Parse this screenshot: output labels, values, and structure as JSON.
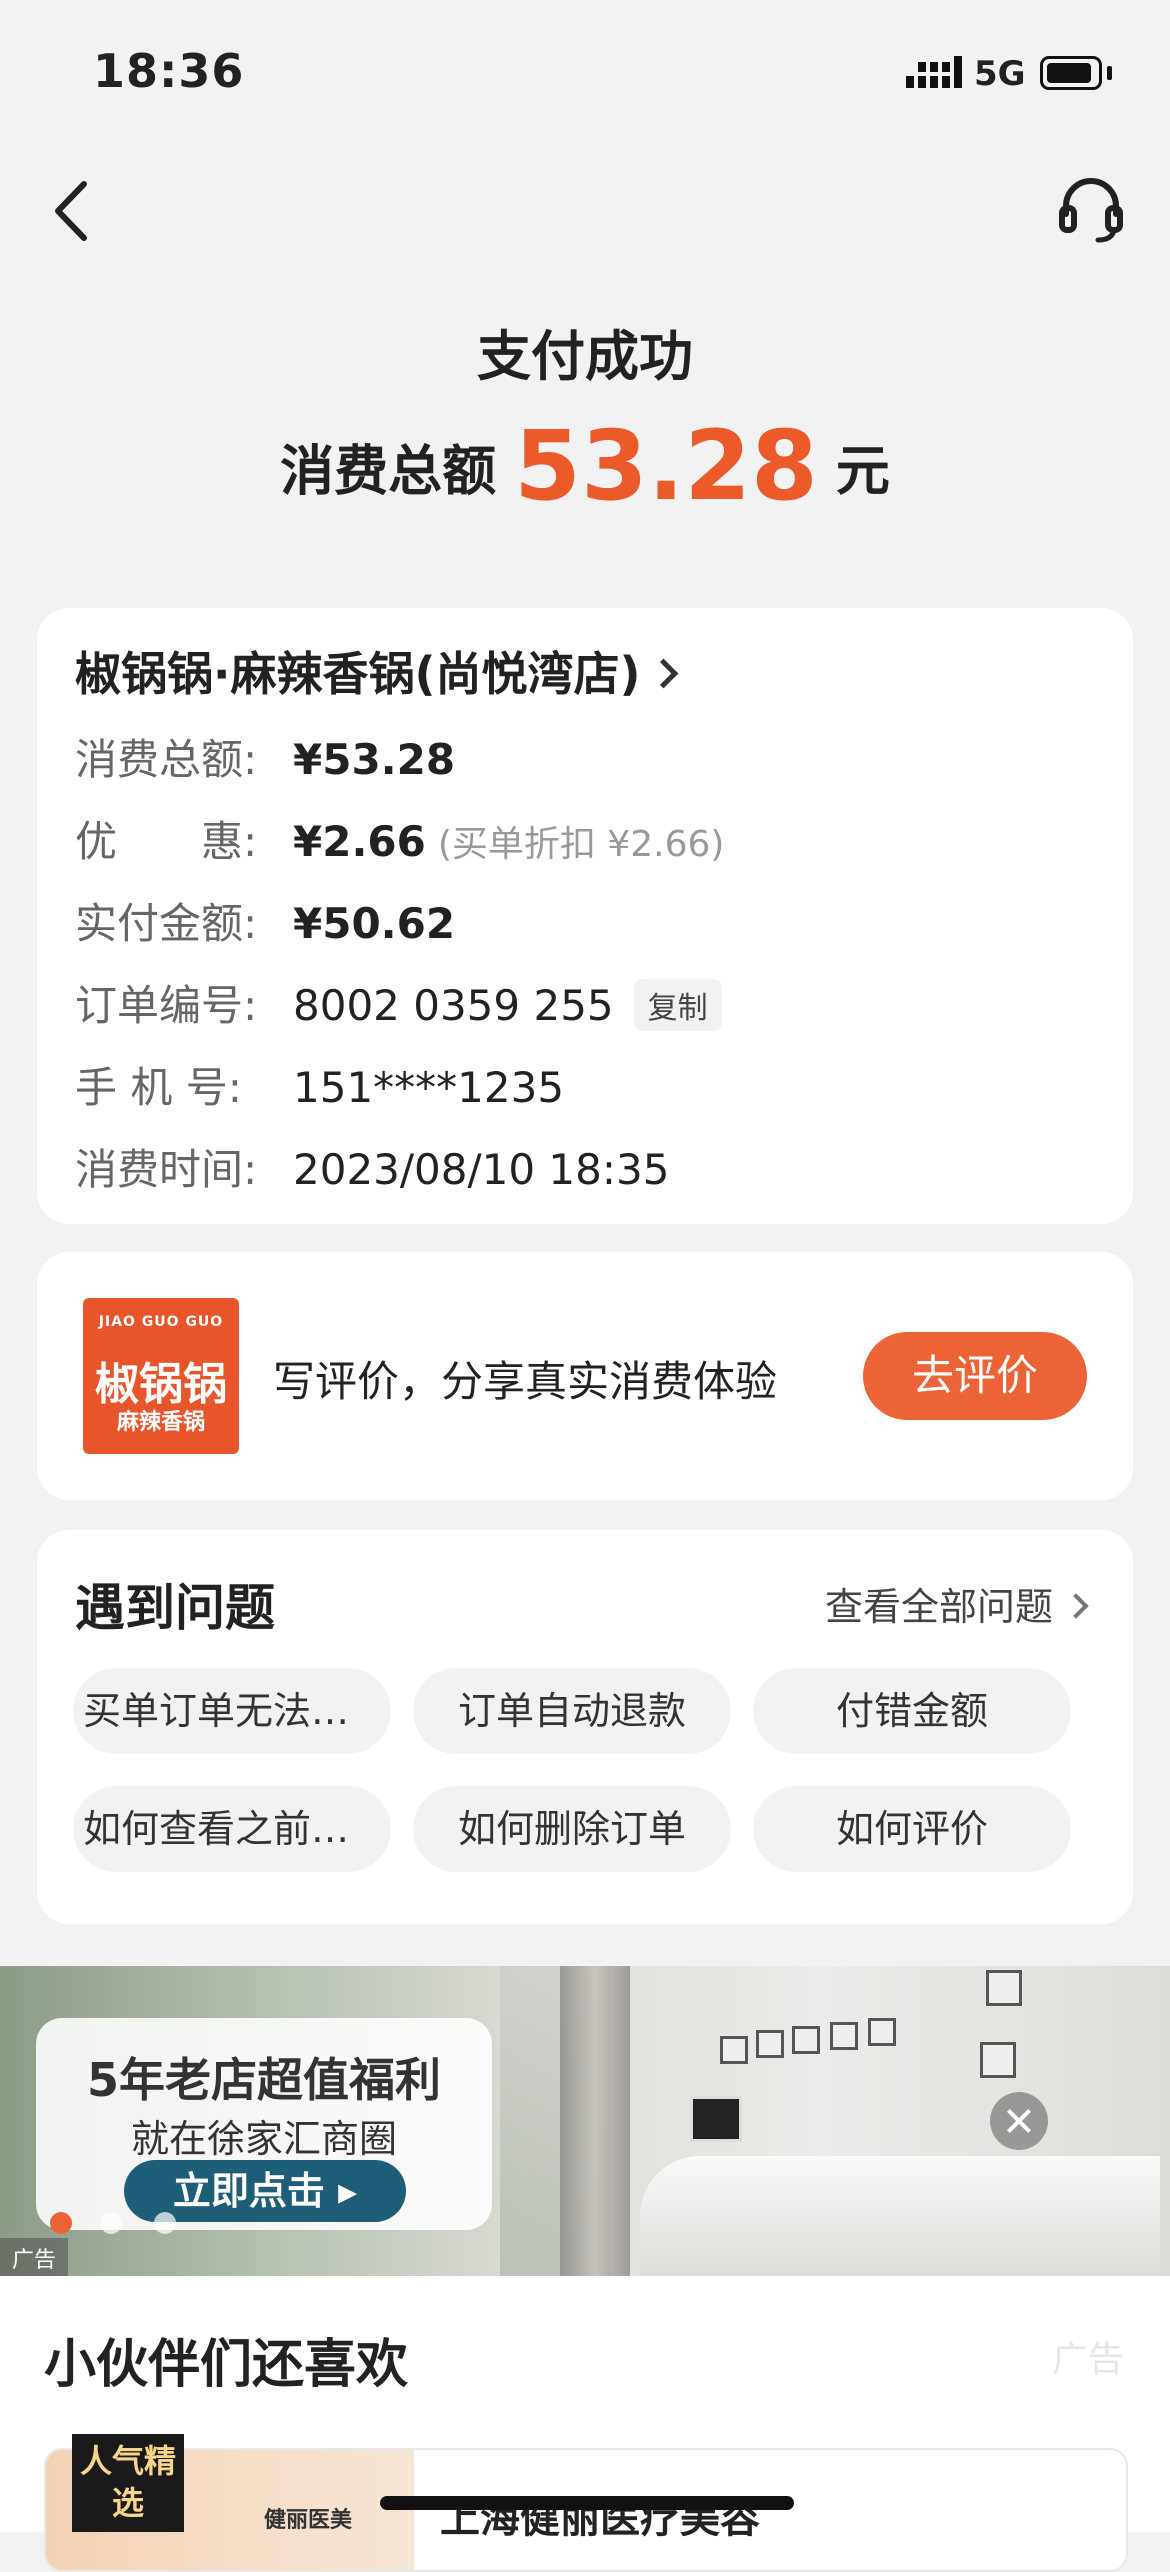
{
  "status_bar": {
    "time": "18:36",
    "network": "5G"
  },
  "header": {
    "title": "支付成功",
    "total_label": "消费总额",
    "total_value": "53.28",
    "total_unit": "元"
  },
  "order": {
    "store_name": "椒锅锅·麻辣香锅(尚悦湾店)",
    "rows": [
      {
        "label": "消费总额:",
        "value": "¥53.28"
      },
      {
        "label": "优　　惠:",
        "value": "¥2.66",
        "note": "(买单折扣 ¥2.66)"
      },
      {
        "label": "实付金额:",
        "value": "¥50.62"
      },
      {
        "label": "订单编号:",
        "value": "8002 0359 255",
        "action": "复制"
      },
      {
        "label": "手  机  号:",
        "value": "151****1235"
      },
      {
        "label": "消费时间:",
        "value": "2023/08/10 18:35"
      }
    ]
  },
  "review": {
    "logo_top": "JIAO GUO GUO",
    "logo_main": "椒锅锅",
    "logo_sub": "麻辣香锅",
    "text": "写评价，分享真实消费体验",
    "button": "去评价",
    "accent": "#ec6338"
  },
  "faq": {
    "title": "遇到问题",
    "view_all": "查看全部问题",
    "chips": [
      "买单订单无法删除",
      "订单自动退款",
      "付错金额",
      "如何查看之前的...",
      "如何删除订单",
      "如何评价"
    ]
  },
  "banner": {
    "line1": "5年老店超值福利",
    "line2": "就在徐家汇商圈",
    "button": "立即点击 ▸",
    "tag": "广告",
    "slide_count": 3,
    "active_slide": 1
  },
  "recommend": {
    "title": "小伙伴们还喜欢",
    "ad_tag": "广告",
    "badge": "人气精选",
    "brand": "健丽医美",
    "name": "上海健丽医疗美容"
  }
}
